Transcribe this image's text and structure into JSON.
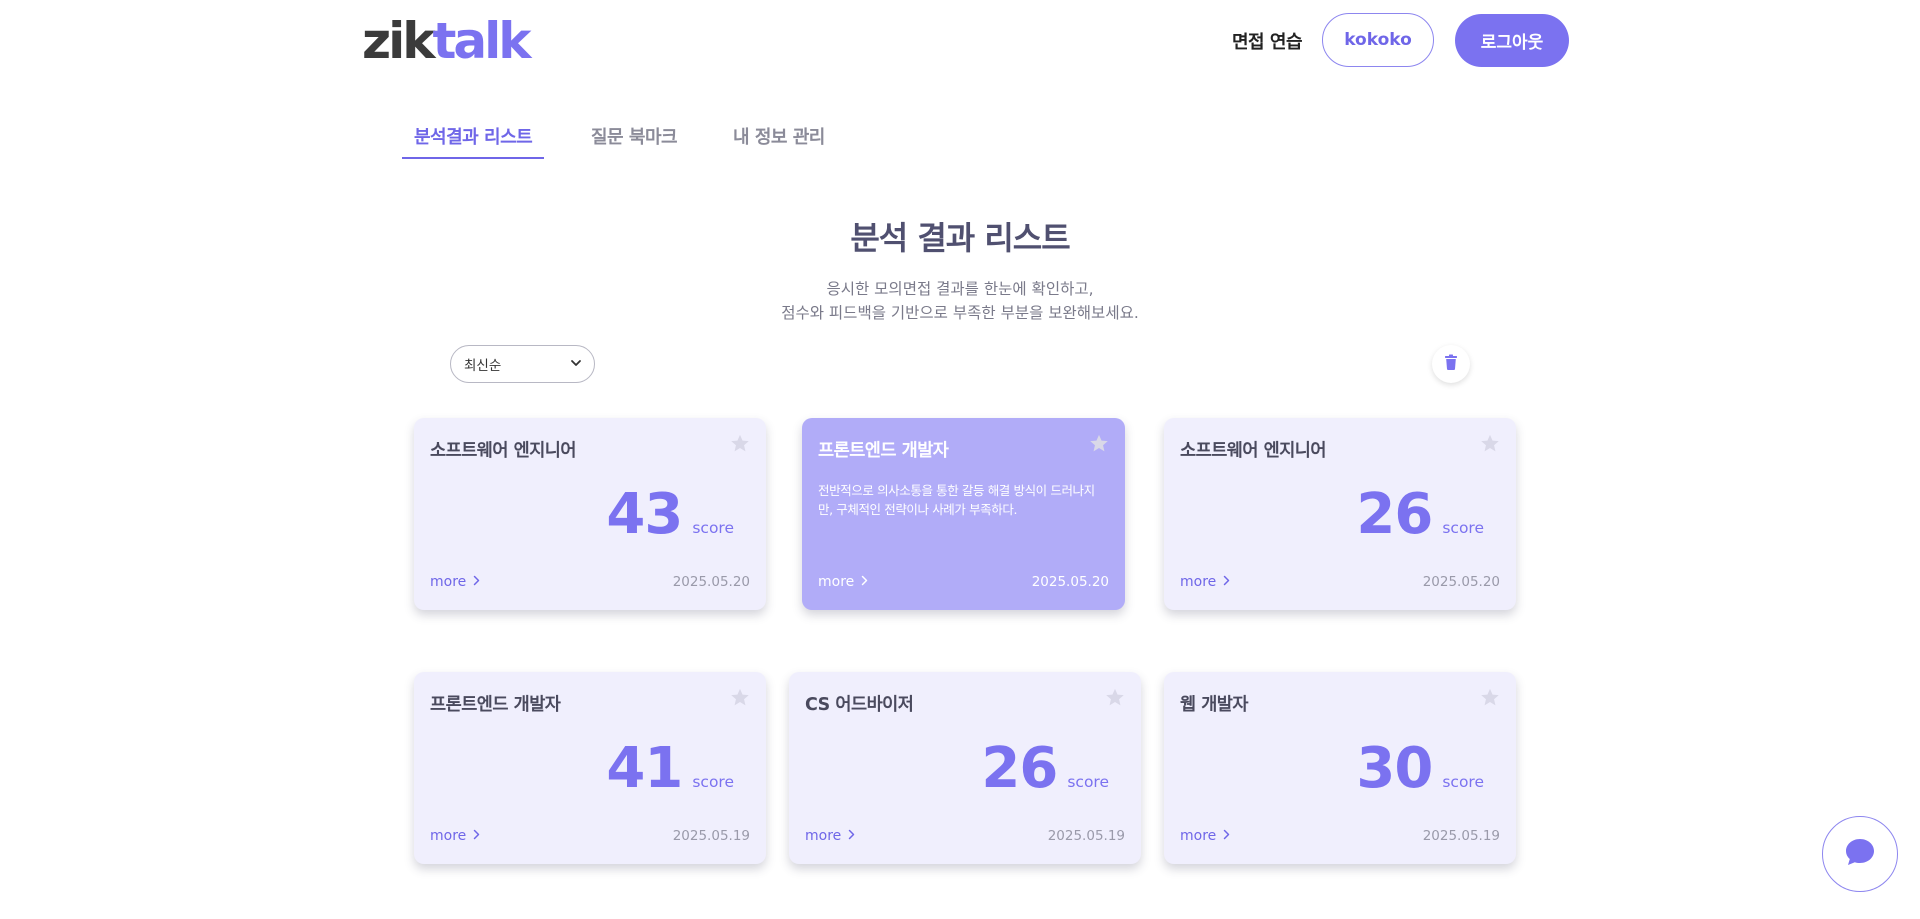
{
  "header": {
    "logo_left": "zik",
    "logo_right": "talk",
    "nav_link": "면접 연습",
    "user_button": "kokoko",
    "logout_button": "로그아웃"
  },
  "tabs": [
    {
      "label": "분석결과 리스트",
      "active": true
    },
    {
      "label": "질문 북마크",
      "active": false
    },
    {
      "label": "내 정보 관리",
      "active": false
    }
  ],
  "main": {
    "title": "분석 결과 리스트",
    "subtitle_line1": "응시한 모의면접 결과를 한눈에 확인하고,",
    "subtitle_line2": "점수와 피드백을 기반으로 부족한 부분을 보완해보세요."
  },
  "controls": {
    "sort_selected": "최신순",
    "trash_icon": "trash-icon"
  },
  "cards": [
    {
      "title": "소프트웨어 엔지니어",
      "score": "43",
      "score_unit": "score",
      "more": "more",
      "date": "2025.05.20",
      "description": ""
    },
    {
      "title": "프론트엔드 개발자",
      "score": "",
      "score_unit": "",
      "more": "more",
      "date": "2025.05.20",
      "description": "전반적으로 의사소통을 통한 갈등 해결 방식이 드러나지만, 구체적인 전략이나 사례가 부족하다."
    },
    {
      "title": "소프트웨어 엔지니어",
      "score": "26",
      "score_unit": "score",
      "more": "more",
      "date": "2025.05.20",
      "description": ""
    },
    {
      "title": "프론트엔드 개발자",
      "score": "41",
      "score_unit": "score",
      "more": "more",
      "date": "2025.05.19",
      "description": ""
    },
    {
      "title": "CS 어드바이저",
      "score": "26",
      "score_unit": "score",
      "more": "more",
      "date": "2025.05.19",
      "description": ""
    },
    {
      "title": "웹 개발자",
      "score": "30",
      "score_unit": "score",
      "more": "more",
      "date": "2025.05.19",
      "description": ""
    }
  ],
  "colors": {
    "accent": "#7b72f0",
    "card_bg": "#f0effd",
    "card_highlight_bg": "#b1acf8",
    "star": "#d9d8e8"
  },
  "chat_icon": "chat-bubble-icon"
}
